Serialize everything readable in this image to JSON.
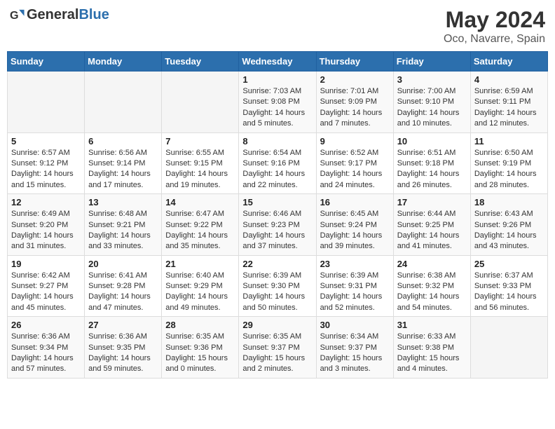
{
  "header": {
    "logo_general": "General",
    "logo_blue": "Blue",
    "month": "May 2024",
    "location": "Oco, Navarre, Spain"
  },
  "days_of_week": [
    "Sunday",
    "Monday",
    "Tuesday",
    "Wednesday",
    "Thursday",
    "Friday",
    "Saturday"
  ],
  "weeks": [
    [
      {
        "day": "",
        "info": ""
      },
      {
        "day": "",
        "info": ""
      },
      {
        "day": "",
        "info": ""
      },
      {
        "day": "1",
        "info": "Sunrise: 7:03 AM\nSunset: 9:08 PM\nDaylight: 14 hours\nand 5 minutes."
      },
      {
        "day": "2",
        "info": "Sunrise: 7:01 AM\nSunset: 9:09 PM\nDaylight: 14 hours\nand 7 minutes."
      },
      {
        "day": "3",
        "info": "Sunrise: 7:00 AM\nSunset: 9:10 PM\nDaylight: 14 hours\nand 10 minutes."
      },
      {
        "day": "4",
        "info": "Sunrise: 6:59 AM\nSunset: 9:11 PM\nDaylight: 14 hours\nand 12 minutes."
      }
    ],
    [
      {
        "day": "5",
        "info": "Sunrise: 6:57 AM\nSunset: 9:12 PM\nDaylight: 14 hours\nand 15 minutes."
      },
      {
        "day": "6",
        "info": "Sunrise: 6:56 AM\nSunset: 9:14 PM\nDaylight: 14 hours\nand 17 minutes."
      },
      {
        "day": "7",
        "info": "Sunrise: 6:55 AM\nSunset: 9:15 PM\nDaylight: 14 hours\nand 19 minutes."
      },
      {
        "day": "8",
        "info": "Sunrise: 6:54 AM\nSunset: 9:16 PM\nDaylight: 14 hours\nand 22 minutes."
      },
      {
        "day": "9",
        "info": "Sunrise: 6:52 AM\nSunset: 9:17 PM\nDaylight: 14 hours\nand 24 minutes."
      },
      {
        "day": "10",
        "info": "Sunrise: 6:51 AM\nSunset: 9:18 PM\nDaylight: 14 hours\nand 26 minutes."
      },
      {
        "day": "11",
        "info": "Sunrise: 6:50 AM\nSunset: 9:19 PM\nDaylight: 14 hours\nand 28 minutes."
      }
    ],
    [
      {
        "day": "12",
        "info": "Sunrise: 6:49 AM\nSunset: 9:20 PM\nDaylight: 14 hours\nand 31 minutes."
      },
      {
        "day": "13",
        "info": "Sunrise: 6:48 AM\nSunset: 9:21 PM\nDaylight: 14 hours\nand 33 minutes."
      },
      {
        "day": "14",
        "info": "Sunrise: 6:47 AM\nSunset: 9:22 PM\nDaylight: 14 hours\nand 35 minutes."
      },
      {
        "day": "15",
        "info": "Sunrise: 6:46 AM\nSunset: 9:23 PM\nDaylight: 14 hours\nand 37 minutes."
      },
      {
        "day": "16",
        "info": "Sunrise: 6:45 AM\nSunset: 9:24 PM\nDaylight: 14 hours\nand 39 minutes."
      },
      {
        "day": "17",
        "info": "Sunrise: 6:44 AM\nSunset: 9:25 PM\nDaylight: 14 hours\nand 41 minutes."
      },
      {
        "day": "18",
        "info": "Sunrise: 6:43 AM\nSunset: 9:26 PM\nDaylight: 14 hours\nand 43 minutes."
      }
    ],
    [
      {
        "day": "19",
        "info": "Sunrise: 6:42 AM\nSunset: 9:27 PM\nDaylight: 14 hours\nand 45 minutes."
      },
      {
        "day": "20",
        "info": "Sunrise: 6:41 AM\nSunset: 9:28 PM\nDaylight: 14 hours\nand 47 minutes."
      },
      {
        "day": "21",
        "info": "Sunrise: 6:40 AM\nSunset: 9:29 PM\nDaylight: 14 hours\nand 49 minutes."
      },
      {
        "day": "22",
        "info": "Sunrise: 6:39 AM\nSunset: 9:30 PM\nDaylight: 14 hours\nand 50 minutes."
      },
      {
        "day": "23",
        "info": "Sunrise: 6:39 AM\nSunset: 9:31 PM\nDaylight: 14 hours\nand 52 minutes."
      },
      {
        "day": "24",
        "info": "Sunrise: 6:38 AM\nSunset: 9:32 PM\nDaylight: 14 hours\nand 54 minutes."
      },
      {
        "day": "25",
        "info": "Sunrise: 6:37 AM\nSunset: 9:33 PM\nDaylight: 14 hours\nand 56 minutes."
      }
    ],
    [
      {
        "day": "26",
        "info": "Sunrise: 6:36 AM\nSunset: 9:34 PM\nDaylight: 14 hours\nand 57 minutes."
      },
      {
        "day": "27",
        "info": "Sunrise: 6:36 AM\nSunset: 9:35 PM\nDaylight: 14 hours\nand 59 minutes."
      },
      {
        "day": "28",
        "info": "Sunrise: 6:35 AM\nSunset: 9:36 PM\nDaylight: 15 hours\nand 0 minutes."
      },
      {
        "day": "29",
        "info": "Sunrise: 6:35 AM\nSunset: 9:37 PM\nDaylight: 15 hours\nand 2 minutes."
      },
      {
        "day": "30",
        "info": "Sunrise: 6:34 AM\nSunset: 9:37 PM\nDaylight: 15 hours\nand 3 minutes."
      },
      {
        "day": "31",
        "info": "Sunrise: 6:33 AM\nSunset: 9:38 PM\nDaylight: 15 hours\nand 4 minutes."
      },
      {
        "day": "",
        "info": ""
      }
    ]
  ]
}
